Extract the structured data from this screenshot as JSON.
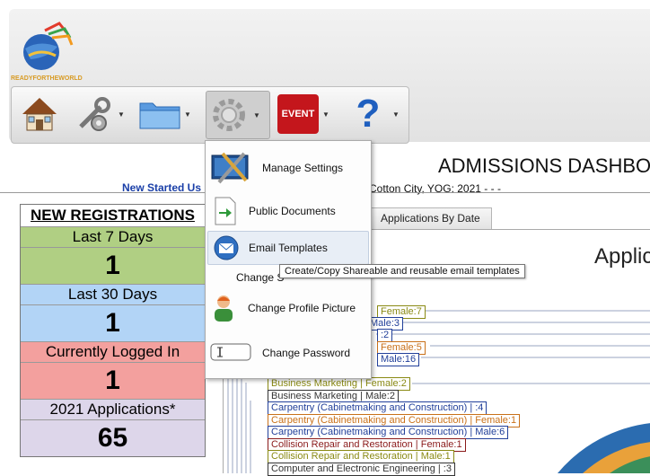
{
  "app": {
    "logo_text": "READYFORTHEWORLD"
  },
  "toolbar": {
    "items": [
      {
        "icon": "home-icon"
      },
      {
        "icon": "tools-icon"
      },
      {
        "icon": "folder-icon"
      },
      {
        "icon": "settings-gear-icon"
      },
      {
        "icon": "event-icon",
        "label": "EVENT"
      },
      {
        "icon": "help-icon",
        "label": "?"
      }
    ]
  },
  "header": {
    "title": "ADMISSIONS DASHBO",
    "started_link": "New Started Us",
    "school_info": "Cotton City, YOG: 2021 - - -"
  },
  "stats": {
    "heading": "NEW REGISTRATIONS",
    "last7_label": "Last 7 Days",
    "last7_value": "1",
    "last30_label": "Last 30 Days",
    "last30_value": "1",
    "logged_label": "Currently Logged In",
    "logged_value": "1",
    "apps_label": "2021 Applications*",
    "apps_value": "65"
  },
  "tabs": {
    "applications_by_date": "Applications By Date"
  },
  "chart": {
    "title": "Applic",
    "legend": [
      {
        "text": "Female:7",
        "color": "#8a8a14"
      },
      {
        "text": "Male:3",
        "color": "#22409a"
      },
      {
        "text": ":2",
        "color": "#22409a"
      },
      {
        "text": "Female:5",
        "color": "#c9711a"
      },
      {
        "text": "Male:16",
        "color": "#22409a"
      },
      {
        "text": "Business Marketing | Female:2",
        "color": "#8a8a14"
      },
      {
        "text": "Business Marketing | Male:2",
        "color": "#333333"
      },
      {
        "text": "Carpentry (Cabinetmaking and Construction) | :4",
        "color": "#22409a"
      },
      {
        "text": "Carpentry (Cabinetmaking and Construction) | Female:1",
        "color": "#c9711a"
      },
      {
        "text": "Carpentry (Cabinetmaking and Construction) | Male:6",
        "color": "#22409a"
      },
      {
        "text": "Collision Repair and Restoration | Female:1",
        "color": "#8a1a1a"
      },
      {
        "text": "Collision Repair and Restoration | Male:1",
        "color": "#8a8a14"
      },
      {
        "text": "Computer and Electronic Engineering | :3",
        "color": "#333333"
      }
    ]
  },
  "menu": {
    "items": [
      {
        "label": "Manage Settings",
        "icon": "manage-settings-icon"
      },
      {
        "label": "Public Documents",
        "icon": "public-documents-icon"
      },
      {
        "label": "Email Templates",
        "icon": "email-icon"
      },
      {
        "label": "Change S",
        "icon": ""
      },
      {
        "label": "Change Profile Picture",
        "icon": "profile-picture-icon"
      },
      {
        "label": "Change Password",
        "icon": "password-icon"
      }
    ]
  },
  "tooltip": {
    "text": "Create/Copy Shareable and reusable email templates"
  }
}
